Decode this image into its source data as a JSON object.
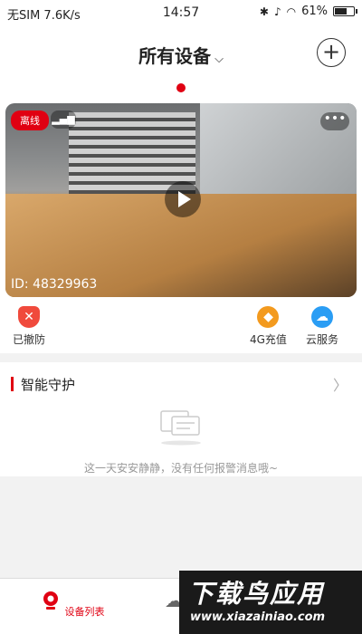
{
  "status_bar": {
    "carrier": "无SIM 7.6K/s",
    "time": "14:57",
    "battery": "61%",
    "battery_level": 0.61
  },
  "header": {
    "title": "所有设备",
    "add_icon": "plus-icon"
  },
  "device": {
    "status_badge": "离线",
    "id_text": "ID: 48329963",
    "play_icon": "play-icon"
  },
  "actions": [
    {
      "label": "已撤防",
      "icon": "shield-x-icon",
      "color": "#f04a3c"
    },
    {
      "label": "4G充值",
      "icon": "sim-recharge-icon",
      "color": "#f39a1e"
    },
    {
      "label": "云服务",
      "icon": "cloud-icon",
      "color": "#2a9df4"
    }
  ],
  "guard": {
    "title": "智能守护",
    "empty_text": "这一天安安静静，没有任何报警消息哦~"
  },
  "tabbar": {
    "tab1": "设备列表"
  },
  "watermark": {
    "line1": "下载鸟应用",
    "line2": "www.xiazainiao.com"
  },
  "colors": {
    "brand": "#e00012"
  }
}
